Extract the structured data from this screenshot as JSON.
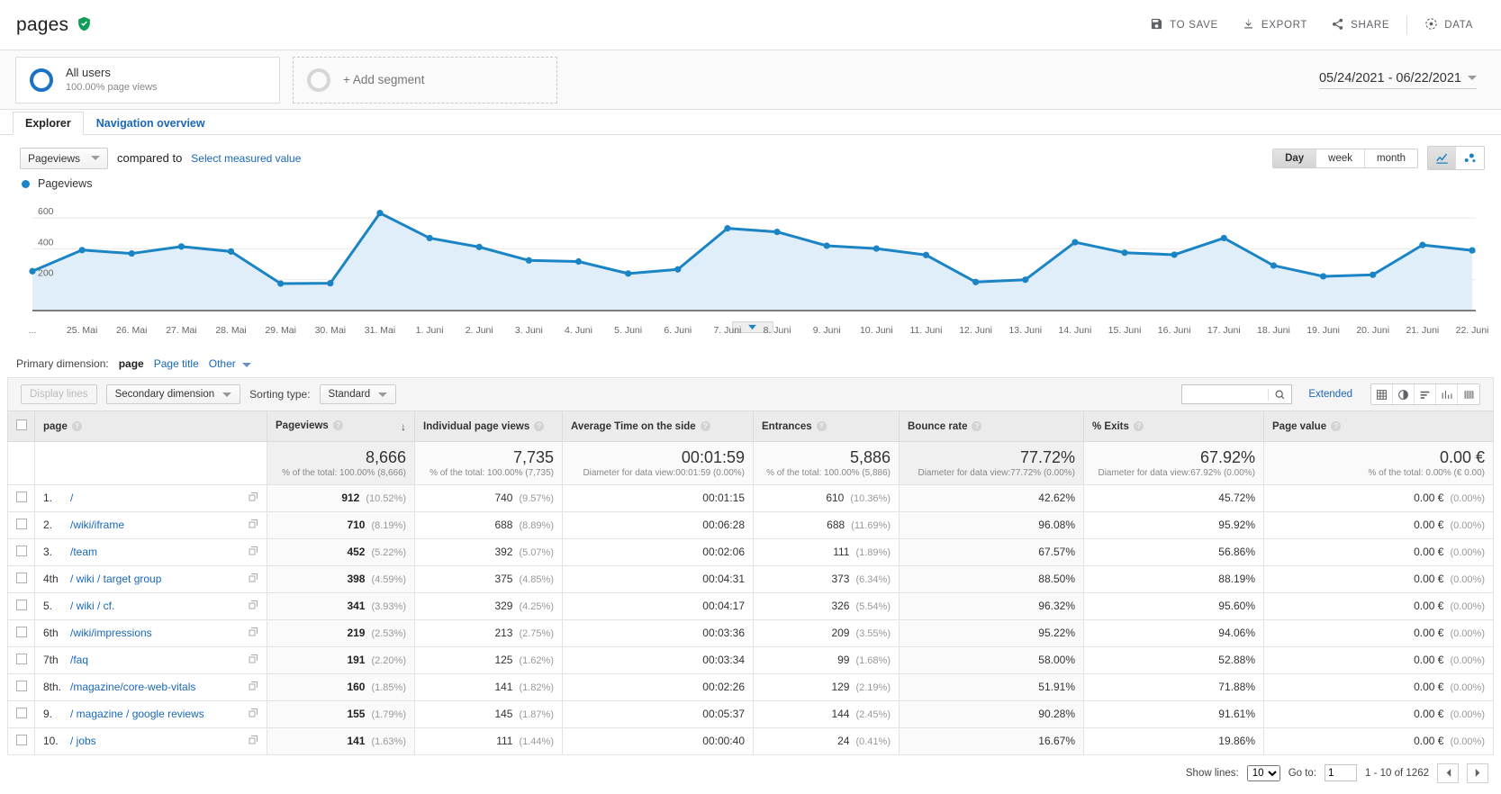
{
  "header": {
    "title": "pages",
    "verified_icon": "verified-shield-icon",
    "actions": [
      {
        "label": "TO SAVE",
        "icon": "save-icon"
      },
      {
        "label": "EXPORT",
        "icon": "download-icon"
      },
      {
        "label": "SHARE",
        "icon": "share-icon"
      },
      {
        "label": "DATA",
        "icon": "data-icon"
      }
    ]
  },
  "segments": {
    "all_users": {
      "name": "All users",
      "sub": "100.00% page views"
    },
    "add_segment": "+ Add segment"
  },
  "date_range": "05/24/2021  -  06/22/2021",
  "tabs": [
    {
      "label": "Explorer",
      "active": true
    },
    {
      "label": "Navigation overview",
      "active": false
    }
  ],
  "chart_controls": {
    "metric": "Pageviews",
    "compared_to": "compared to",
    "select_measured_value": "Select measured value",
    "granularity": [
      {
        "label": "Day",
        "active": true
      },
      {
        "label": "week",
        "active": false
      },
      {
        "label": "month",
        "active": false
      }
    ],
    "view_icons": [
      {
        "name": "line-chart-icon",
        "active": true
      },
      {
        "name": "motion-chart-icon",
        "active": false
      }
    ]
  },
  "chart_data": {
    "type": "area",
    "title": "Pageviews",
    "legend": [
      "Pageviews"
    ],
    "legend_position": "top-left",
    "grid": true,
    "xlabel": "",
    "ylabel": "",
    "ylim": [
      0,
      700
    ],
    "yticks": [
      200,
      400,
      600
    ],
    "line_color": "#1b84c4",
    "fill_color": "#dfeef8",
    "categories": [
      "...",
      "25. Mai",
      "26. Mai",
      "27. Mai",
      "28. Mai",
      "29. Mai",
      "30. Mai",
      "31. Mai",
      "1. Juni",
      "2. Juni",
      "3. Juni",
      "4. Juni",
      "5. Juni",
      "6. Juni",
      "7. Juni",
      "8. Juni",
      "9. Juni",
      "10. Juni",
      "11. Juni",
      "12. Juni",
      "13. Juni",
      "14. Juni",
      "15. Juni",
      "16. Juni",
      "17. Juni",
      "18. Juni",
      "19. Juni",
      "20. Juni",
      "21. Juni",
      "22. Juni"
    ],
    "values": [
      255,
      392,
      370,
      415,
      383,
      175,
      177,
      632,
      470,
      412,
      325,
      318,
      240,
      267,
      533,
      510,
      420,
      402,
      360,
      185,
      200,
      443,
      375,
      362,
      470,
      292,
      222,
      232,
      425,
      390
    ]
  },
  "primary_dimension": {
    "label": "Primary dimension:",
    "options": [
      "page",
      "Page title",
      "Other"
    ],
    "active": "page"
  },
  "table_toolbar": {
    "display_lines": "Display lines",
    "secondary_dimension": "Secondary dimension",
    "sorting_type_label": "Sorting type:",
    "sorting_type_value": "Standard",
    "search_placeholder": "",
    "search_value": "",
    "extended": "Extended",
    "view_icons": [
      "table-view-icon",
      "pie-view-icon",
      "bar-view-icon",
      "performance-view-icon",
      "pivot-view-icon"
    ]
  },
  "table": {
    "columns": [
      {
        "key": "page",
        "label": "page",
        "help": true,
        "sorted": false
      },
      {
        "key": "pageviews",
        "label": "Pageviews",
        "help": true,
        "sorted": true
      },
      {
        "key": "individual",
        "label": "Individual page views",
        "help": true,
        "sorted": false
      },
      {
        "key": "avgtime",
        "label": "Average Time on the side",
        "help": true,
        "sorted": false
      },
      {
        "key": "entrances",
        "label": "Entrances",
        "help": true,
        "sorted": false
      },
      {
        "key": "bounce",
        "label": "Bounce rate",
        "help": true,
        "sorted": false
      },
      {
        "key": "exits",
        "label": "% Exits",
        "help": true,
        "sorted": false
      },
      {
        "key": "pagevalue",
        "label": "Page value",
        "help": true,
        "sorted": false
      }
    ],
    "summary": {
      "pageviews": {
        "value": "8,666",
        "note": "% of the total: 100.00% (8,666)"
      },
      "individual": {
        "value": "7,735",
        "note": "% of the total: 100.00% (7,735)"
      },
      "avgtime": {
        "value": "00:01:59",
        "note": "Diameter for data view:00:01:59 (0.00%)"
      },
      "entrances": {
        "value": "5,886",
        "note": "% of the total: 100.00% (5,886)"
      },
      "bounce": {
        "value": "77.72%",
        "note": "Diameter for data view:77.72% (0.00%)"
      },
      "exits": {
        "value": "67.92%",
        "note": "Diameter for data view:67.92% (0.00%)"
      },
      "pagevalue": {
        "value": "0.00 €",
        "note": "% of the total: 0.00% (€ 0.00)"
      }
    },
    "rows": [
      {
        "index": "1.",
        "page": "/",
        "pageviews": "912",
        "pv_pct": "(10.52%)",
        "individual": "740",
        "iv_pct": "(9.57%)",
        "avgtime": "00:01:15",
        "entrances": "610",
        "en_pct": "(10.36%)",
        "bounce": "42.62%",
        "exits": "45.72%",
        "pagevalue": "0.00 €",
        "pval_pct": "(0.00%)"
      },
      {
        "index": "2.",
        "page": "/wiki/iframe",
        "pageviews": "710",
        "pv_pct": "(8.19%)",
        "individual": "688",
        "iv_pct": "(8.89%)",
        "avgtime": "00:06:28",
        "entrances": "688",
        "en_pct": "(11.69%)",
        "bounce": "96.08%",
        "exits": "95.92%",
        "pagevalue": "0.00 €",
        "pval_pct": "(0.00%)"
      },
      {
        "index": "3.",
        "page": "/team",
        "pageviews": "452",
        "pv_pct": "(5.22%)",
        "individual": "392",
        "iv_pct": "(5.07%)",
        "avgtime": "00:02:06",
        "entrances": "111",
        "en_pct": "(1.89%)",
        "bounce": "67.57%",
        "exits": "56.86%",
        "pagevalue": "0.00 €",
        "pval_pct": "(0.00%)"
      },
      {
        "index": "4th",
        "page": "/ wiki / target group",
        "pageviews": "398",
        "pv_pct": "(4.59%)",
        "individual": "375",
        "iv_pct": "(4.85%)",
        "avgtime": "00:04:31",
        "entrances": "373",
        "en_pct": "(6.34%)",
        "bounce": "88.50%",
        "exits": "88.19%",
        "pagevalue": "0.00 €",
        "pval_pct": "(0.00%)"
      },
      {
        "index": "5.",
        "page": "/ wiki / cf.",
        "pageviews": "341",
        "pv_pct": "(3.93%)",
        "individual": "329",
        "iv_pct": "(4.25%)",
        "avgtime": "00:04:17",
        "entrances": "326",
        "en_pct": "(5.54%)",
        "bounce": "96.32%",
        "exits": "95.60%",
        "pagevalue": "0.00 €",
        "pval_pct": "(0.00%)"
      },
      {
        "index": "6th",
        "page": "/wiki/impressions",
        "pageviews": "219",
        "pv_pct": "(2.53%)",
        "individual": "213",
        "iv_pct": "(2.75%)",
        "avgtime": "00:03:36",
        "entrances": "209",
        "en_pct": "(3.55%)",
        "bounce": "95.22%",
        "exits": "94.06%",
        "pagevalue": "0.00 €",
        "pval_pct": "(0.00%)"
      },
      {
        "index": "7th",
        "page": "/faq",
        "pageviews": "191",
        "pv_pct": "(2.20%)",
        "individual": "125",
        "iv_pct": "(1.62%)",
        "avgtime": "00:03:34",
        "entrances": "99",
        "en_pct": "(1.68%)",
        "bounce": "58.00%",
        "exits": "52.88%",
        "pagevalue": "0.00 €",
        "pval_pct": "(0.00%)"
      },
      {
        "index": "8th.",
        "page": "/magazine/core-web-vitals",
        "pageviews": "160",
        "pv_pct": "(1.85%)",
        "individual": "141",
        "iv_pct": "(1.82%)",
        "avgtime": "00:02:26",
        "entrances": "129",
        "en_pct": "(2.19%)",
        "bounce": "51.91%",
        "exits": "71.88%",
        "pagevalue": "0.00 €",
        "pval_pct": "(0.00%)"
      },
      {
        "index": "9.",
        "page": "/ magazine / google reviews",
        "pageviews": "155",
        "pv_pct": "(1.79%)",
        "individual": "145",
        "iv_pct": "(1.87%)",
        "avgtime": "00:05:37",
        "entrances": "144",
        "en_pct": "(2.45%)",
        "bounce": "90.28%",
        "exits": "91.61%",
        "pagevalue": "0.00 €",
        "pval_pct": "(0.00%)"
      },
      {
        "index": "10.",
        "page": "/ jobs",
        "pageviews": "141",
        "pv_pct": "(1.63%)",
        "individual": "111",
        "iv_pct": "(1.44%)",
        "avgtime": "00:00:40",
        "entrances": "24",
        "en_pct": "(0.41%)",
        "bounce": "16.67%",
        "exits": "19.86%",
        "pagevalue": "0.00 €",
        "pval_pct": "(0.00%)"
      }
    ]
  },
  "footer": {
    "show_lines_label": "Show lines:",
    "show_lines_value": "10",
    "goto_label": "Go to:",
    "goto_value": "1",
    "range_text": "1 - 10 of 1262",
    "prev_icon": "chevron-left-icon",
    "next_icon": "chevron-right-icon"
  }
}
